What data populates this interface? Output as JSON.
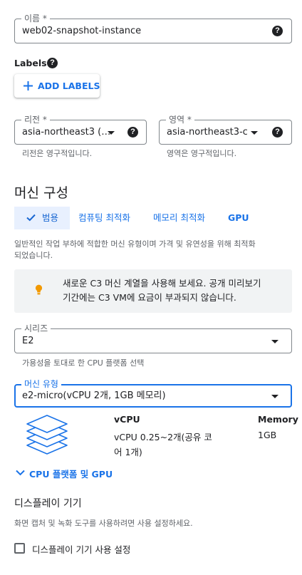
{
  "name_field": {
    "label": "이름 *",
    "value": "web02-snapshot-instance"
  },
  "labels": {
    "heading": "Labels",
    "add_button": "ADD LABELS"
  },
  "region_field": {
    "label": "리전 *",
    "value": "asia-northeast3 (…",
    "hint": "리전은 영구적입니다."
  },
  "zone_field": {
    "label": "영역 *",
    "value": "asia-northeast3-c",
    "hint": "영역은 영구적입니다."
  },
  "machine_config": {
    "title": "머신 구성",
    "tabs": [
      {
        "label": "범용",
        "active": true
      },
      {
        "label": "컴퓨팅 최적화",
        "active": false
      },
      {
        "label": "메모리 최적화",
        "active": false
      },
      {
        "label": "GPU",
        "active": false
      }
    ],
    "description_line1": "일반적인 작업 부하에 적합한 머신 유형이며 가격 및 유연성을 위해 최적화",
    "description_line2": "되었습니다.",
    "info_line1": "새로운 C3 머신 계열을 사용해 보세요. 공개 미리보기",
    "info_line2": "기간에는 C3 VM에 요금이 부과되지 않습니다."
  },
  "series_field": {
    "label": "시리즈",
    "value": "E2",
    "hint": "가용성을 토대로 한 CPU 플랫폼 선택"
  },
  "machine_type_field": {
    "label": "머신 유형",
    "value": "e2-micro(vCPU 2개, 1GB 메모리)"
  },
  "spec": {
    "vcpu_header": "vCPU",
    "memory_header": "Memory",
    "vcpu_value_line1": "vCPU 0.25~2개(공유 코",
    "vcpu_value_line2": "어 1개)",
    "memory_value": "1GB"
  },
  "cpu_platform_toggle": "CPU 플랫폼 및 GPU",
  "display_device": {
    "title": "디스플레이 기기",
    "description": "화면 캡처 및 녹화 도구를 사용하려면 사용 설정하세요.",
    "checkbox_label": "디스플레이 기기 사용 설정",
    "checked": false
  },
  "colors": {
    "accent": "#1a73e8",
    "active_tab_bg": "#e8f0fe",
    "info_bg": "#f1f3f4",
    "info_icon": "#f29900"
  },
  "icons": {
    "help": "help-circle-icon",
    "add": "plus-icon",
    "check": "check-icon",
    "info": "lightbulb-icon",
    "dropdown": "arrow-drop-down-icon",
    "expand": "chevron-down-icon",
    "machine": "stacked-layers-icon"
  }
}
